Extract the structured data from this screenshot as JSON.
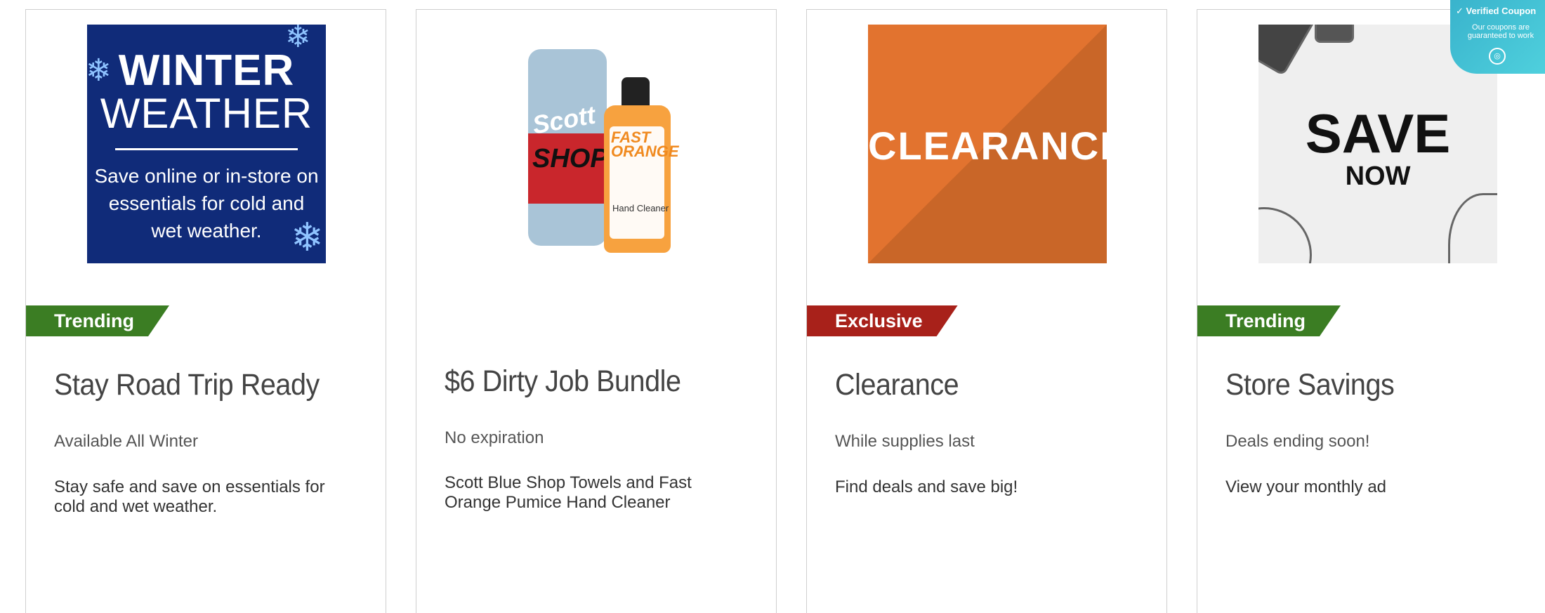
{
  "cards": [
    {
      "image": {
        "type": "winter",
        "line1": "WINTER",
        "line2": "WEATHER",
        "text": "Save online or in-store on essentials for cold and wet weather."
      },
      "badge": "Trending",
      "title": "Stay Road Trip Ready",
      "subtitle": "Available All Winter",
      "description": "Stay safe and save on essentials for cold and wet weather."
    },
    {
      "image": {
        "type": "product-bundle",
        "brand1": "Scott",
        "brand1b": "SHOP",
        "brand2": "FAST ORANGE",
        "label": "Hand Cleaner"
      },
      "badge": "",
      "title": "$6 Dirty Job Bundle",
      "subtitle": "No expiration",
      "description": "Scott Blue Shop Towels and Fast Orange Pumice Hand Cleaner"
    },
    {
      "image": {
        "type": "clearance",
        "text": "CLEARANCE"
      },
      "badge": "Exclusive",
      "title": "Clearance",
      "subtitle": "While supplies last",
      "description": "Find deals and save big!"
    },
    {
      "image": {
        "type": "save",
        "line1": "SAVE",
        "line2": "NOW"
      },
      "badge": "Trending",
      "title": "Store Savings",
      "subtitle": "Deals ending soon!",
      "description": "View your monthly ad"
    }
  ],
  "colors": {
    "trending": "#3b7d23",
    "exclusive": "#a8211a"
  },
  "coupon_widget": {
    "title": "Verified Coupon",
    "text": "Our coupons are guaranteed to work",
    "icon": "coupon-icon"
  }
}
